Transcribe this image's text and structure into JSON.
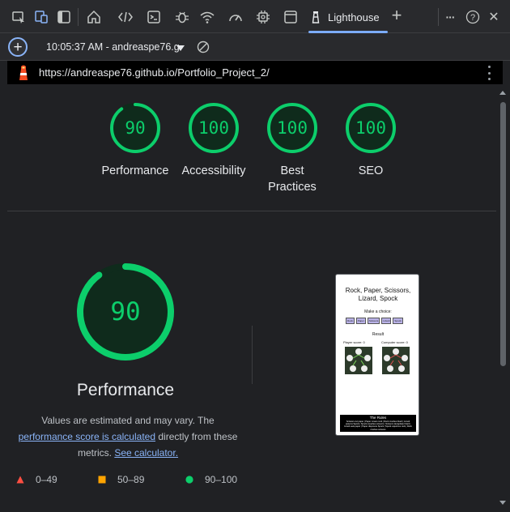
{
  "devtools": {
    "active_tab": "Lighthouse",
    "toolbar_icons": [
      "inspect-icon",
      "device-emulation-icon",
      "sidebar-toggle-icon",
      "welcome-home-icon",
      "elements-code-icon",
      "console-icon",
      "sources-bug-icon",
      "network-wifi-icon",
      "performance-gauge-icon",
      "memory-chip-icon",
      "application-window-icon",
      "lighthouse-icon",
      "new-tab-plus-icon",
      "more-tools-icon",
      "help-icon",
      "close-icon"
    ],
    "new_tab_symbol": "+",
    "more_symbol": "···",
    "help_symbol": "?",
    "close_symbol": "✕"
  },
  "report_bar": {
    "add_symbol": "+",
    "report_selector": "10:05:37 AM - andreaspe76.g"
  },
  "url_bar": {
    "url": "https://andreaspe76.github.io/Portfolio_Project_2/"
  },
  "summary_scores": [
    {
      "label": "Performance",
      "score": 90
    },
    {
      "label": "Accessibility",
      "score": 100
    },
    {
      "label": "Best\nPractices",
      "score": 100
    },
    {
      "label": "SEO",
      "score": 100
    }
  ],
  "performance": {
    "score": 90,
    "title": "Performance",
    "desc_before": "Values are estimated and may vary. The",
    "desc_link": "performance score is calculated",
    "desc_middle": "directly from these metrics.",
    "desc_link2": "See calculator."
  },
  "legend": [
    {
      "range": "0–49",
      "shape": "triangle",
      "color": "#ff4e42"
    },
    {
      "range": "50–89",
      "shape": "square",
      "color": "#ffa400"
    },
    {
      "range": "90–100",
      "shape": "circle",
      "color": "#0cce6b"
    }
  ],
  "screenshot_preview": {
    "title": "Rock, Paper, Scissors, Lizard, Spock",
    "choice": "Make a choice:",
    "buttons": [
      "Rock",
      "Paper",
      "Scissors",
      "Lizard",
      "Spock"
    ],
    "result": "Result",
    "player_score": "Player score: 0",
    "computer_score": "Computer score: 0",
    "rules_title": "The Rules",
    "rules_text": "Scissors cut paper | Paper covers rock | Rock crushes lizard | Lizard poisons Spock | Spock smashes scissors | Scissors decapitate lizard | Lizard eats paper | Paper disproves Spock | Spock vaporizes rock | Rock crushes scissors"
  },
  "colors": {
    "pass": "#0cce6b",
    "pass_bg": "#0f2b1c",
    "link": "#8ab4f8"
  }
}
